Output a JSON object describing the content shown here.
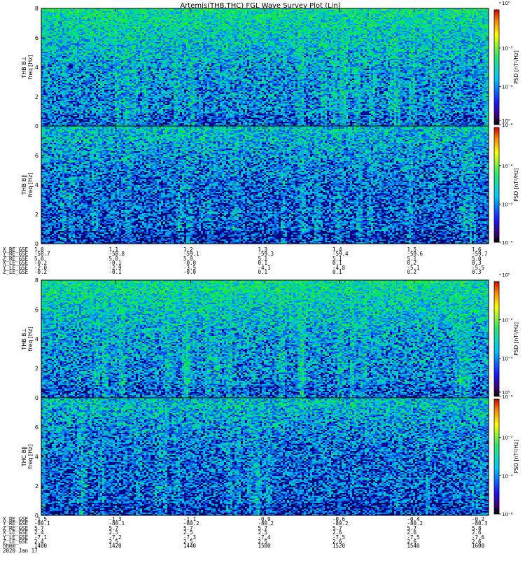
{
  "title": "Artemis(THB,THC) FGL Wave Survey Plot (Lin)",
  "colorbar": {
    "label": "PSD [nT²/Hz]",
    "ticks": [
      "10⁰",
      "10⁻²",
      "10⁻⁴",
      "10⁻⁶"
    ]
  },
  "colors": {
    "noise_low": "#0a1a9a",
    "noise_mid": "#1f9be0",
    "noise_high": "#3fdc6a",
    "border": "#000000"
  },
  "chart_data": [
    {
      "type": "heatmap",
      "name": "THB B⊥",
      "ylabel_top": "THB B⊥",
      "ylabel_bottom": "freq [Hz]",
      "yticks": [
        "0",
        "2",
        "4",
        "6",
        "8"
      ],
      "ylim": [
        0,
        8
      ],
      "zscale": "log",
      "zlim": [
        1e-06,
        1.0
      ]
    },
    {
      "type": "heatmap",
      "name": "THB B‖",
      "ylabel_top": "THB B‖",
      "ylabel_bottom": "freq [Hz]",
      "yticks": [
        "0",
        "2",
        "4",
        "6"
      ],
      "ylim": [
        0,
        8
      ],
      "zscale": "log",
      "zlim": [
        1e-06,
        1.0
      ]
    },
    {
      "type": "heatmap",
      "name": "THB B⊥ (second)",
      "ylabel_top": "THB B⊥",
      "ylabel_bottom": "freq [Hz]",
      "yticks": [
        "0",
        "2",
        "4",
        "6",
        "8"
      ],
      "ylim": [
        0,
        8
      ],
      "zscale": "log",
      "zlim": [
        1e-06,
        1.0
      ]
    },
    {
      "type": "heatmap",
      "name": "THC B‖",
      "ylabel_top": "THC B‖",
      "ylabel_bottom": "freq [Hz]",
      "yticks": [
        "0",
        "2",
        "4",
        "6"
      ],
      "ylim": [
        0,
        8
      ],
      "zscale": "log",
      "zlim": [
        1e-06,
        1.0
      ]
    }
  ],
  "ephemeris_top": {
    "labels": [
      "X_RE_GSE",
      "Y_RE_GSE",
      "Z_RE_GSE",
      "X_LE_GSE",
      "Y_LE_GSE",
      "Z_LE_GSE"
    ],
    "columns": [
      [
        "1.0",
        "-58.7",
        "5.0",
        "-0.2",
        "-2.0",
        "-0.2"
      ],
      [
        "1.1",
        "-58.8",
        "5.0",
        "-0.1",
        "-2.9",
        "-0.1"
      ],
      [
        "1.2",
        "-59.1",
        "5.0",
        "-0.0",
        "-3.5",
        "-0.0"
      ],
      [
        "1.3",
        "-59.3",
        "5.1",
        "0.1",
        "-4.1",
        "0.1"
      ],
      [
        "1.4",
        "-59.4",
        "5.1",
        "0.1",
        "-4.8",
        "0.1"
      ],
      [
        "1.5",
        "-59.6",
        "5.1",
        "0.2",
        "-5.1",
        "0.2"
      ],
      [
        "1.6",
        "-59.7",
        "5.0",
        "0.3",
        "-5.5",
        "0.3"
      ]
    ]
  },
  "ephemeris_bottom": {
    "labels": [
      "X_RE_GSE",
      "Y_RE_GSE",
      "Z_RE_GSE",
      "X_LE_GSE",
      "Y_LE_GSE",
      "Z_LE_GSE",
      "hhmm",
      "2020 Jan 17"
    ],
    "columns": [
      [
        "-1.5",
        "-80.1",
        "5.7",
        "2.4",
        "-7.1",
        "2.4",
        "1400",
        ""
      ],
      [
        "-1.3",
        "-80.1",
        "5.7",
        "2.5",
        "-7.2",
        "2.5",
        "1420",
        ""
      ],
      [
        "-1.1",
        "-80.2",
        "5.7",
        "2.5",
        "-7.3",
        "2.5",
        "1440",
        ""
      ],
      [
        "-0.9",
        "-80.2",
        "5.7",
        "2.5",
        "-7.4",
        "2.5",
        "1500",
        ""
      ],
      [
        "-0.6",
        "-80.2",
        "5.7",
        "2.6",
        "-7.5",
        "2.6",
        "1520",
        ""
      ],
      [
        "-0.4",
        "-80.2",
        "5.7",
        "2.6",
        "-7.5",
        "2.6",
        "1540",
        ""
      ],
      [
        "-0.2",
        "-80.3",
        "5.8",
        "2.6",
        "-7.6",
        "2.6",
        "1600",
        ""
      ]
    ]
  }
}
